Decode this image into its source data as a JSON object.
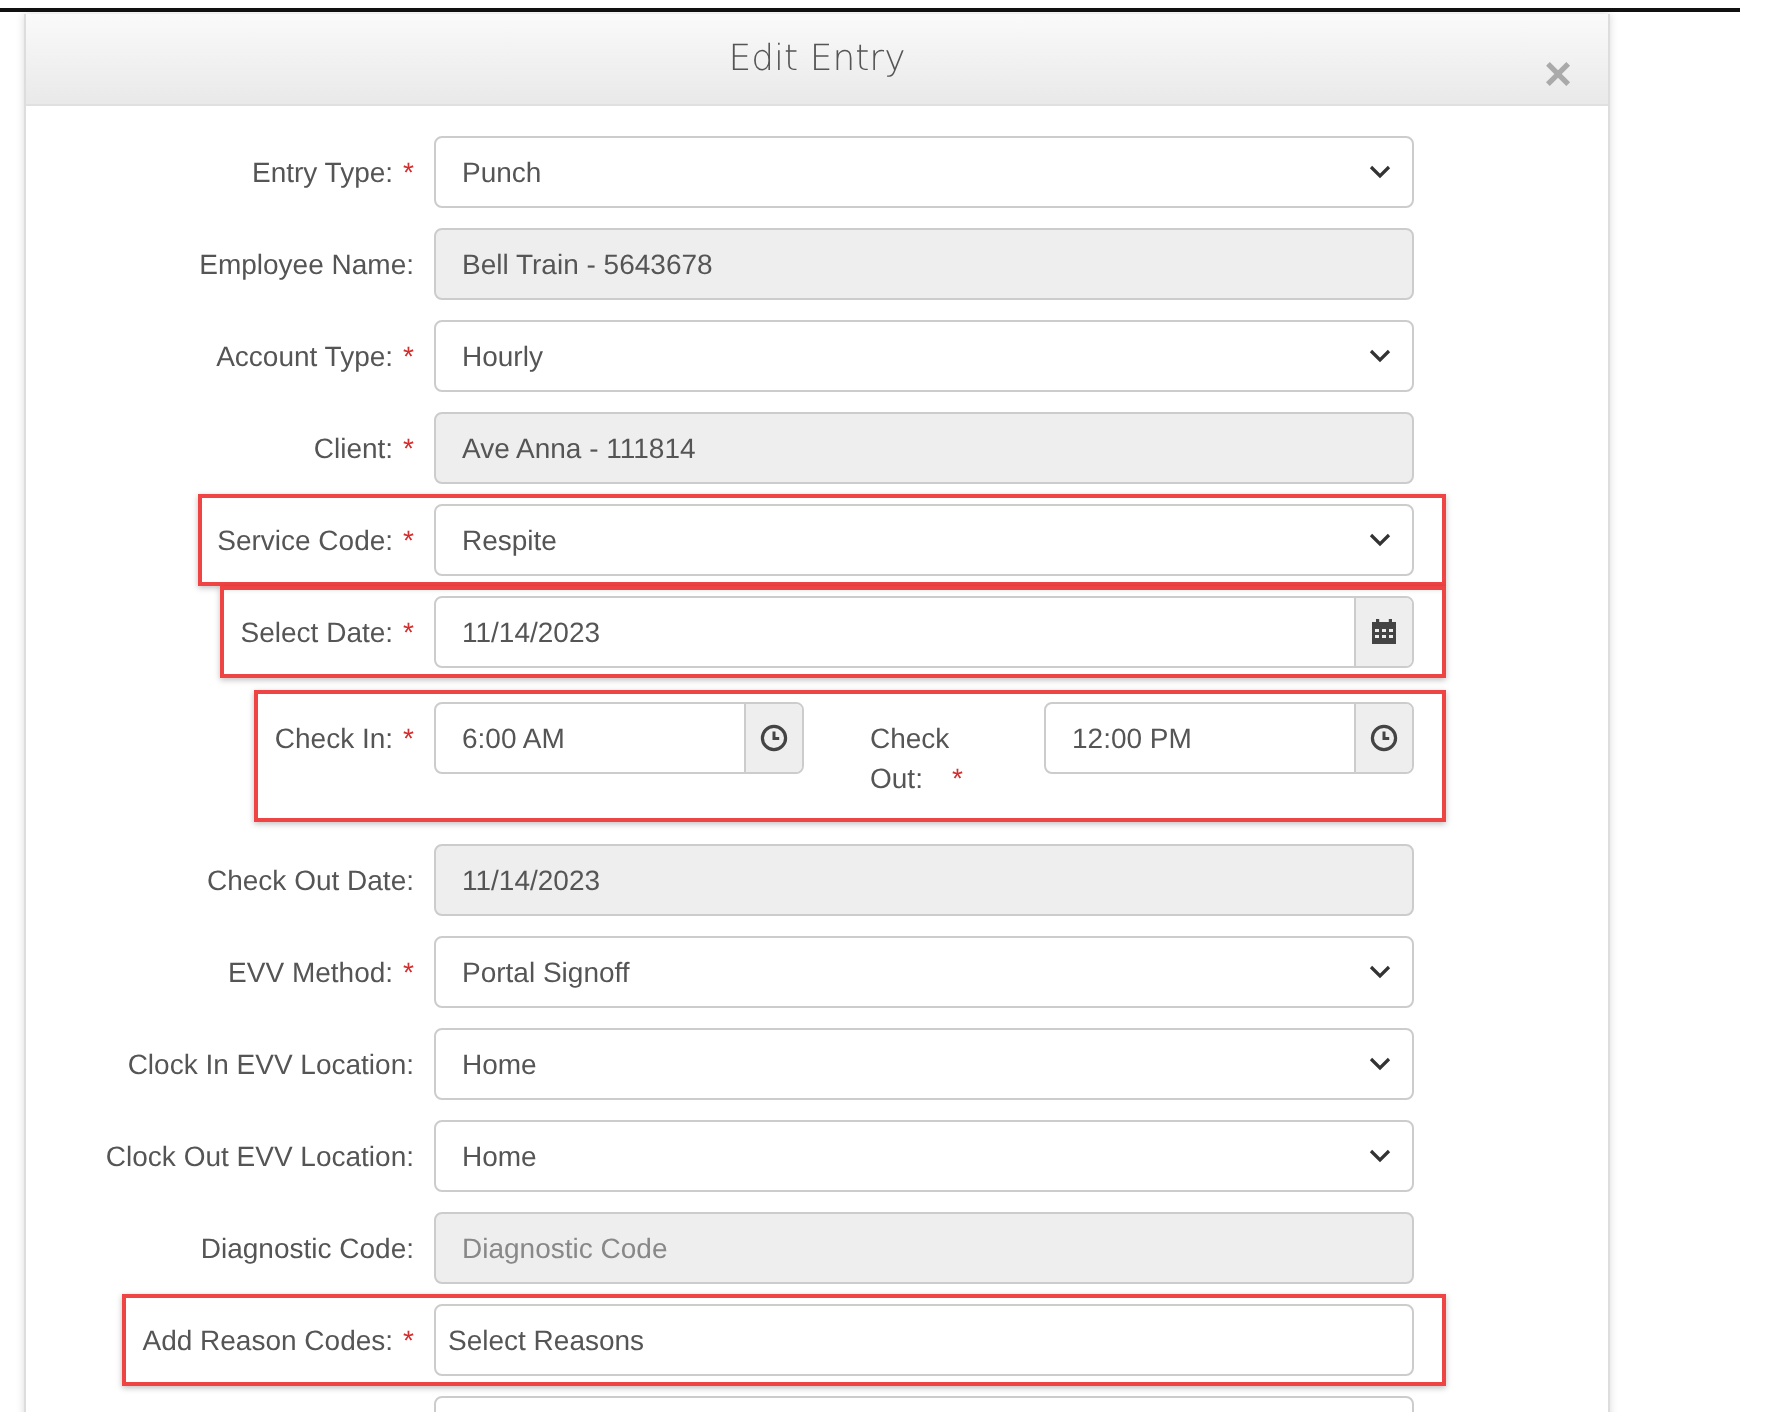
{
  "dialog": {
    "title": "Edit Entry",
    "close": "×"
  },
  "fields": [
    {
      "kind": "select",
      "label": "Entry Type:",
      "required": "*",
      "value": "Punch",
      "highlighted": false
    },
    {
      "kind": "readonly",
      "label": "Employee Name:",
      "value": "Bell Train - 5643678",
      "highlighted": false
    },
    {
      "kind": "select",
      "label": "Account Type:",
      "required": "*",
      "value": "Hourly",
      "highlighted": false
    },
    {
      "kind": "readonly",
      "label": "Client:",
      "required": "*",
      "value": "Ave Anna - 111814",
      "highlighted": false
    },
    {
      "kind": "select",
      "label": "Service Code:",
      "required": "*",
      "value": "Respite",
      "highlighted": true
    },
    {
      "kind": "date",
      "label": "Select Date:",
      "required": "*",
      "value": "11/14/2023",
      "highlighted": true
    },
    {
      "kind": "time-pair",
      "label": "Check In:",
      "required": "*",
      "value": "6:00 AM",
      "end_label": "Check Out:",
      "end_required": "*",
      "end_value": "12:00 PM",
      "highlighted": true
    },
    {
      "kind": "readonly",
      "label": "Check Out Date:",
      "value": "11/14/2023",
      "highlighted": false
    },
    {
      "kind": "select",
      "label": "EVV Method:",
      "required": "*",
      "value": "Portal Signoff",
      "highlighted": false
    },
    {
      "kind": "select",
      "label": "Clock In EVV Location:",
      "value": "Home",
      "highlighted": false
    },
    {
      "kind": "select",
      "label": "Clock Out EVV Location:",
      "value": "Home",
      "highlighted": false
    },
    {
      "kind": "readonly",
      "label": "Diagnostic Code:",
      "placeholder": "Diagnostic Code",
      "highlighted": false
    },
    {
      "kind": "text",
      "label": "Add Reason Codes:",
      "required": "*",
      "placeholder": "Select Reasons",
      "highlighted": true
    },
    {
      "kind": "blank",
      "highlighted": false
    }
  ]
}
